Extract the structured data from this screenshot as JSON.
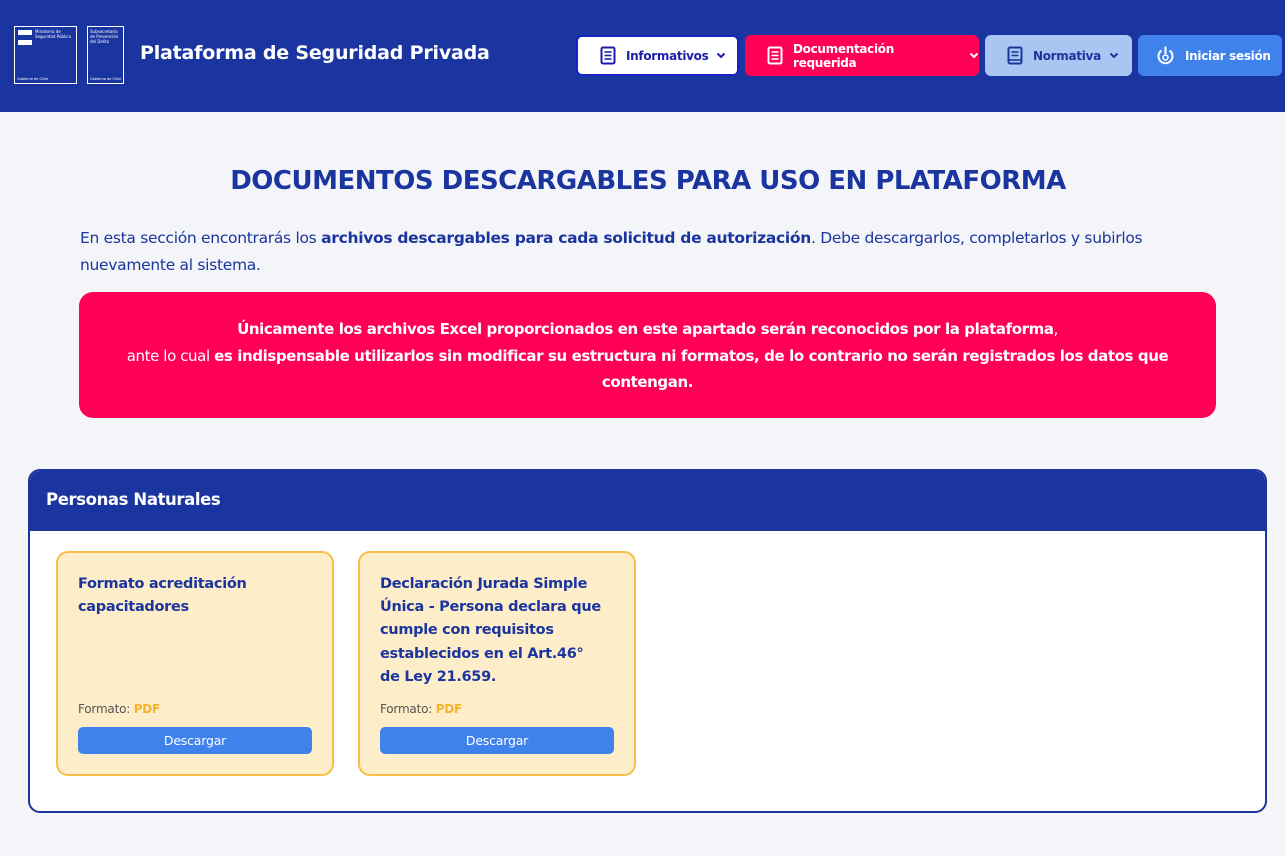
{
  "header": {
    "logo_primary_text": "Ministerio de Seguridad Pública",
    "logo_primary_footer": "Gobierno de Chile",
    "logo_secondary_text": "Subsecretaría de Prevención del Delito",
    "logo_secondary_footer": "Gobierno de Chile",
    "site_title": "Plataforma de Seguridad Privada",
    "nav": {
      "informativos": "Informativos",
      "documentacion": "Documentación requerida",
      "normativa": "Normativa",
      "login": "Iniciar sesión"
    }
  },
  "main": {
    "heading": "DOCUMENTOS DESCARGABLES PARA USO EN PLATAFORMA",
    "intro_pre": "En esta sección encontrarás los ",
    "intro_bold": "archivos descargables para cada solicitud de autorización",
    "intro_post": ". Debe descargarlos, completarlos y subirlos nuevamente al sistema.",
    "alert": {
      "line1_bold": "Únicamente los archivos Excel proporcionados en este apartado serán reconocidos por la plataforma",
      "line1_post": ",",
      "line2_pre": "ante lo cual ",
      "line2_bold": "es indispensable utilizarlos sin modificar su estructura ni formatos, de lo contrario no serán registrados los datos que contengan."
    }
  },
  "section": {
    "title": "Personas Naturales",
    "cards": [
      {
        "title": "Formato acreditación capacitadores",
        "format_label": "Formato:",
        "format_value": "PDF",
        "button": "Descargar"
      },
      {
        "title": "Declaración Jurada Simple Única - Persona declara que cumple con requisitos establecidos en el Art.46° de Ley 21.659.",
        "format_label": "Formato:",
        "format_value": "PDF",
        "button": "Descargar"
      }
    ]
  },
  "colors": {
    "primary": "#1b35a0",
    "alert": "#ff0055",
    "accent_blue": "#3f82ec",
    "card_bg": "#feedc9",
    "card_border": "#f8bf48",
    "format_color": "#f7b32b"
  },
  "icons": {
    "informativos": "document-icon",
    "documentacion": "document-icon",
    "normativa": "book-icon",
    "login": "power-icon",
    "dropdown": "chevron-down-icon"
  }
}
